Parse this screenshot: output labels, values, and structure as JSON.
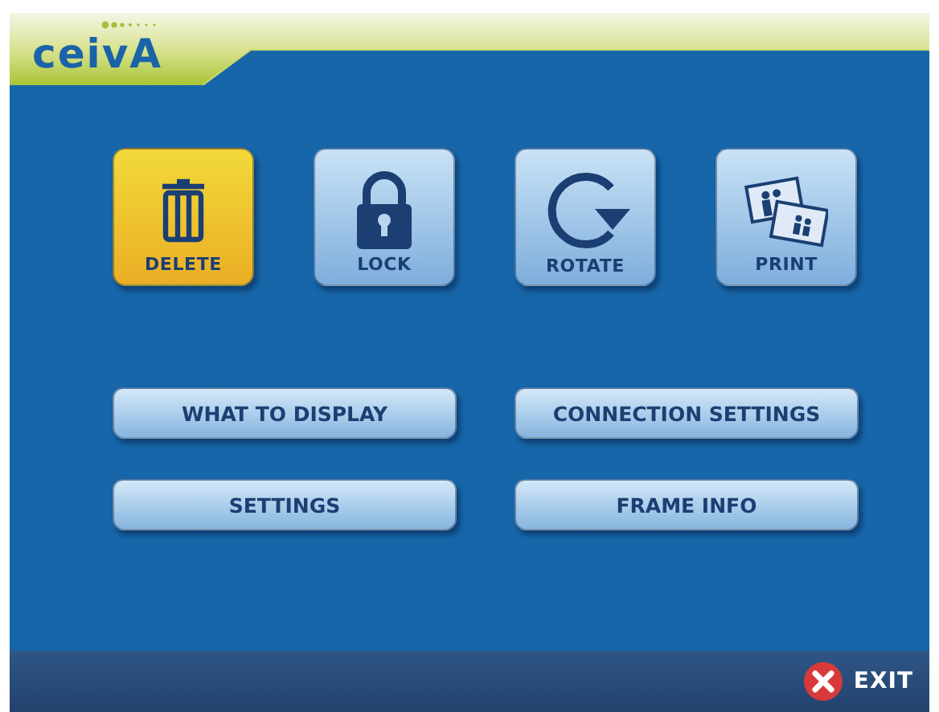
{
  "logo": "ceivA",
  "actions": [
    {
      "kind": "delete",
      "label": "DELETE",
      "selected": true
    },
    {
      "kind": "lock",
      "label": "LOCK",
      "selected": false
    },
    {
      "kind": "rotate",
      "label": "ROTATE",
      "selected": false
    },
    {
      "kind": "print",
      "label": "PRINT",
      "selected": false
    }
  ],
  "menu_buttons": [
    "WHAT TO DISPLAY",
    "CONNECTION SETTINGS",
    "SETTINGS",
    "FRAME INFO"
  ],
  "exit_button": "EXIT"
}
